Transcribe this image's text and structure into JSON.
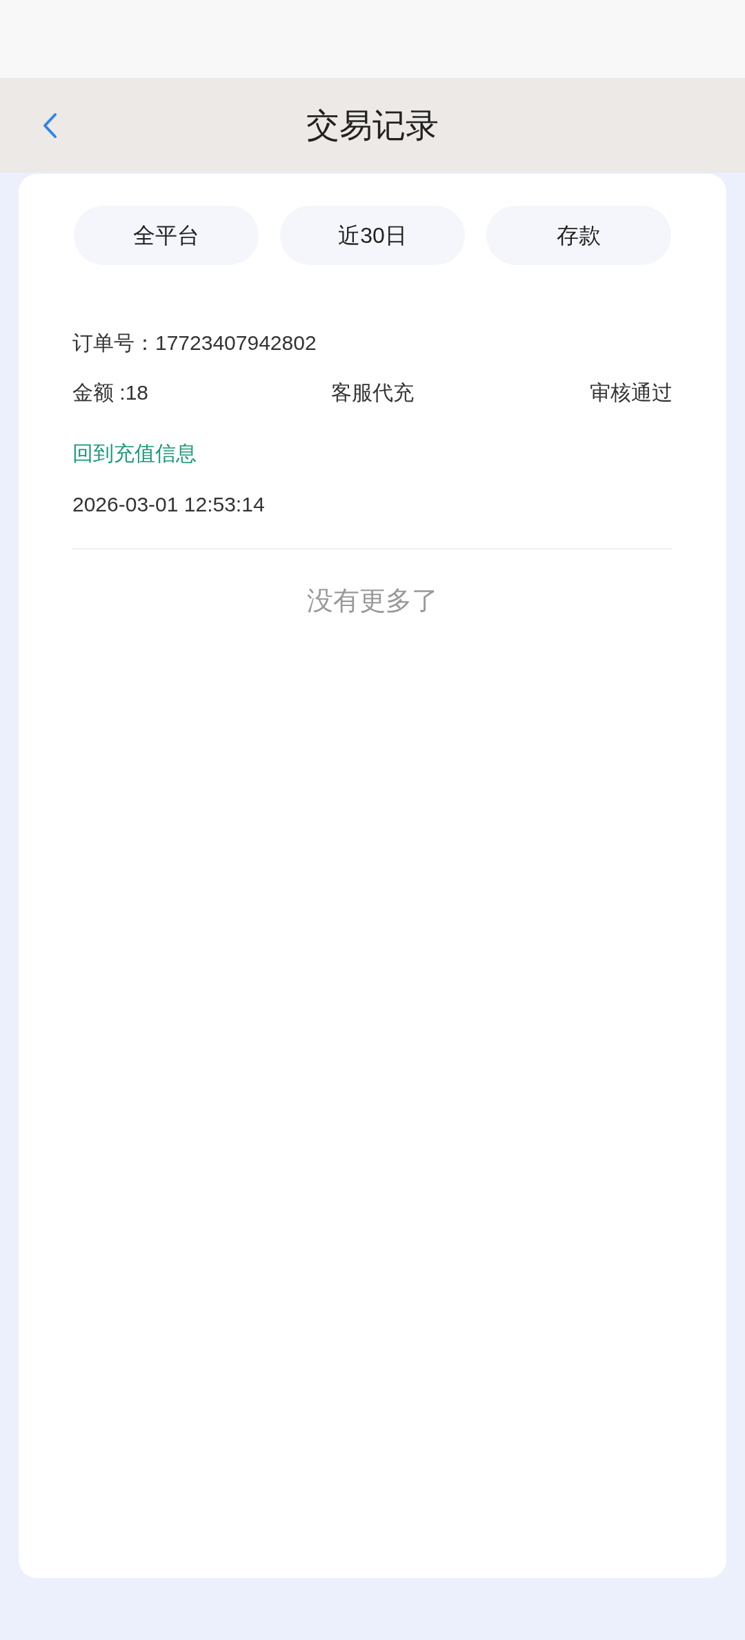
{
  "header": {
    "title": "交易记录"
  },
  "filters": [
    {
      "label": "全平台"
    },
    {
      "label": "近30日"
    },
    {
      "label": "存款"
    }
  ],
  "records": [
    {
      "order_no": "订单号：17723407942802",
      "amount": "金额 :18",
      "method": "客服代充",
      "status": "审核通过",
      "link": "回到充值信息",
      "time": "2026-03-01 12:53:14"
    }
  ],
  "end_text": "没有更多了"
}
